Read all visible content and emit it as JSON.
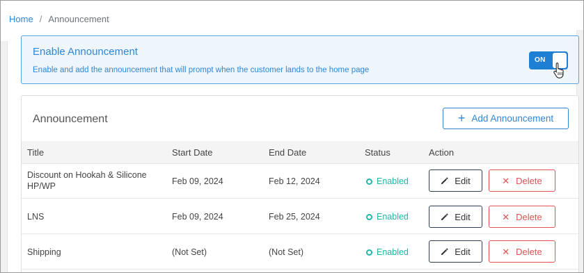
{
  "breadcrumb": {
    "home": "Home",
    "separator": "/",
    "current": "Announcement"
  },
  "enable_panel": {
    "title": "Enable Announcement",
    "description": "Enable and add the announcement that will prompt when the customer lands to the home page",
    "toggle_label": "ON"
  },
  "list": {
    "title": "Announcement",
    "add_button": "Add Announcement",
    "columns": [
      "Title",
      "Start Date",
      "End Date",
      "Status",
      "Action"
    ],
    "rows": [
      {
        "title_line1": "Discount on Hookah & Silicone",
        "title_line2": "HP/WP",
        "start": "Feb 09, 2024",
        "end": "Feb 12, 2024",
        "status": "Enabled",
        "edit": "Edit",
        "delete": "Delete"
      },
      {
        "title_line1": "LNS",
        "title_line2": "",
        "start": "Feb 09, 2024",
        "end": "Feb 25, 2024",
        "status": "Enabled",
        "edit": "Edit",
        "delete": "Delete"
      },
      {
        "title_line1": "Shipping",
        "title_line2": "",
        "start": "(Not Set)",
        "end": "(Not Set)",
        "status": "Enabled",
        "edit": "Edit",
        "delete": "Delete"
      }
    ]
  },
  "colors": {
    "accent": "#2f86d6",
    "toggle_on": "#1f7fd4",
    "enabled": "#1fb6a6",
    "danger": "#e05252"
  }
}
